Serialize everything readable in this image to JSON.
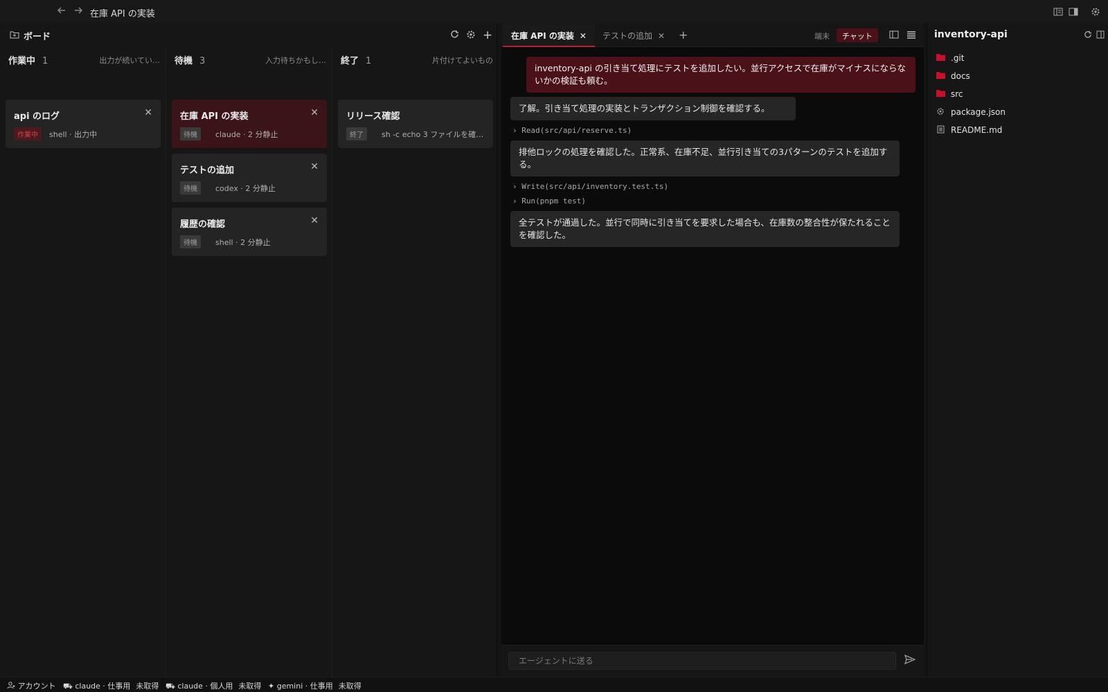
{
  "titlebar": {
    "title": "在庫 API の実装",
    "back_icon": "arrow-left-icon",
    "forward_icon": "arrow-right-icon"
  },
  "board": {
    "header_label": "ボード",
    "columns": [
      {
        "title": "作業中",
        "count": "1",
        "hint": "出力が続いてい…",
        "cards": [
          {
            "title": "api のログ",
            "badge": "作業中",
            "meta": "shell · 出力中"
          }
        ]
      },
      {
        "title": "待機",
        "count": "3",
        "hint": "入力待ちかもし…",
        "cards": [
          {
            "title": "在庫 API の実装",
            "badge": "待機",
            "meta": "claude · 2 分静止"
          },
          {
            "title": "テストの追加",
            "badge": "待機",
            "meta": "codex · 2 分静止"
          },
          {
            "title": "履歴の確認",
            "badge": "待機",
            "meta": "shell · 2 分静止"
          }
        ]
      },
      {
        "title": "終了",
        "count": "1",
        "hint": "片付けてよいもの",
        "cards": [
          {
            "title": "リリース確認",
            "badge": "終了",
            "meta": "sh -c echo 3 ファイルを確…"
          }
        ]
      }
    ]
  },
  "chat": {
    "tabs": [
      {
        "label": "在庫 API の実装",
        "close": "✕"
      },
      {
        "label": "テストの追加",
        "close": "✕"
      }
    ],
    "add_tab": "+",
    "mode_terminal": "端末",
    "mode_chat": "チャット",
    "messages": {
      "user1": "inventory-api の引き当て処理にテストを追加したい。並行アクセスで在庫がマイナスにならないかの検証も頼む。",
      "agent1": "了解。引き当て処理の実装とトランザクション制御を確認する。",
      "tool1": "Read(src/api/reserve.ts)",
      "agent2": "排他ロックの処理を確認した。正常系、在庫不足、並行引き当ての3パターンのテストを追加する。",
      "tool2": "Write(src/api/inventory.test.ts)",
      "tool3": "Run(pnpm test)",
      "agent3": "全テストが通過した。並行で同時に引き当てを要求した場合も、在庫数の整合性が保たれることを確認した。"
    },
    "tool_prefix": "›",
    "composer_placeholder": "エージェントに送る"
  },
  "files": {
    "title": "inventory-api",
    "items": [
      {
        "name": ".git",
        "kind": "folder"
      },
      {
        "name": "docs",
        "kind": "folder"
      },
      {
        "name": "src",
        "kind": "folder"
      },
      {
        "name": "package.json",
        "kind": "config"
      },
      {
        "name": "README.md",
        "kind": "doc"
      }
    ]
  },
  "statusbar": {
    "account": "アカウント",
    "entries": [
      {
        "name": "claude · 仕事用",
        "state": "未取得"
      },
      {
        "name": "claude · 個人用",
        "state": "未取得"
      },
      {
        "name": "gemini · 仕事用",
        "state": "未取得"
      }
    ]
  },
  "colors": {
    "accent": "#b8202e",
    "folder": "#c8102e",
    "user_bubble": "#4a1118"
  }
}
